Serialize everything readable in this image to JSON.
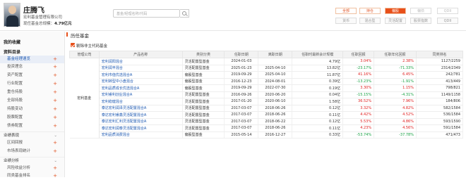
{
  "manager": {
    "name": "庄腾飞",
    "company": "宏利基金管理有限公司",
    "scale_label": "现任基金总规模：",
    "scale_value": "4.79亿元"
  },
  "search": {
    "placeholder": "基金/经理名称/代码"
  },
  "tabs_row1": [
    "全部",
    "持仓",
    "偏股",
    "偏债",
    "QDII"
  ],
  "tabs_row1_active": "偏股",
  "tabs_row2": [
    "货币",
    "混合型",
    "灵活配置",
    "股票指数",
    "QDII"
  ],
  "sidebar": {
    "my_collect": "我的收藏",
    "profile": "资料目录",
    "items": [
      "基金经理速览",
      "投资理念",
      "资产配置",
      "行业配置",
      "重仓持股",
      "全部持股",
      "持股变动",
      "股票配置",
      "债券配置"
    ],
    "sections": [
      "业绩表现",
      "业绩分析"
    ],
    "section1_items": [
      "区间回报",
      "市场表现统计"
    ],
    "section2_items": [
      "风险收益分析",
      "同类基金排名"
    ]
  },
  "main": {
    "title": "历任基金",
    "checkbox_label": "剔除非主代码基金",
    "columns": [
      "管理公司",
      "产品名称",
      "类别分类",
      "任职日期",
      "离职日期",
      "任职时最新会计规模",
      "任职回报",
      "任职年化回报",
      "同类排名"
    ],
    "company": "宏利基金",
    "rows": [
      {
        "name": "宏利润阳混合",
        "type": "灵活配置型基金",
        "start": "2024-01-03",
        "end": "",
        "scale": "4.79亿",
        "ret": "3.04%",
        "annual": "2.38%",
        "rank": "1127/2259"
      },
      {
        "name": "宏利润丰混合",
        "type": "灵活配置型基金",
        "start": "2025-01-23",
        "end": "2025-04-10",
        "scale": "13.82亿",
        "ret": "-23.17%",
        "annual": "-71.33%",
        "rank": "2314/2349"
      },
      {
        "name": "宏利市值优选混合A",
        "type": "偏股型基金",
        "start": "2019-09-29",
        "end": "2025-04-10",
        "scale": "11.87亿",
        "ret": "41.16%",
        "annual": "6.45%",
        "rank": "242/781"
      },
      {
        "name": "宏利转型中小盘混合",
        "type": "偏股型基金",
        "start": "2016-12-23",
        "end": "2024-08-01",
        "scale": "0.39亿",
        "ret": "-13.23%",
        "annual": "-1.91%",
        "rank": "413/449"
      },
      {
        "name": "宏利品质成长优选混合A",
        "type": "偏股型基金",
        "start": "2019-09-29",
        "end": "2022-07-30",
        "scale": "0.19亿",
        "ret": "3.30%",
        "annual": "1.15%",
        "rank": "798/821"
      },
      {
        "name": "宏利睿利创业混合A",
        "type": "灵活配置型基金",
        "start": "2016-09-26",
        "end": "2020-06-20",
        "scale": "0.04亿",
        "ret": "-15.15%",
        "annual": "-4.31%",
        "rank": "1149/1158"
      },
      {
        "name": "宏利稳健混合",
        "type": "灵活配置型基金",
        "start": "2017-01-20",
        "end": "2020-06-10",
        "scale": "1.58亿",
        "ret": "36.52%",
        "annual": "7.96%",
        "rank": "184/806"
      },
      {
        "name": "泰达宏利润泽灵活配置混合A",
        "type": "灵活配置型基金",
        "start": "2017-03-07",
        "end": "2018-06-26",
        "scale": "0.12亿",
        "ret": "3.32%",
        "annual": "4.82%",
        "rank": "582/1584"
      },
      {
        "name": "泰达宏利睿鑫灵活配置混合A",
        "type": "灵活配置型基金",
        "start": "2017-03-07",
        "end": "2018-06-26",
        "scale": "0.11亿",
        "ret": "4.42%",
        "annual": "4.52%",
        "rank": "536/1584"
      },
      {
        "name": "泰达宏利汇利灵活配置混合A",
        "type": "灵活配置型基金",
        "start": "2017-03-07",
        "end": "2018-06-22",
        "scale": "0.12亿",
        "ret": "5.53%",
        "annual": "4.86%",
        "rank": "593/1590"
      },
      {
        "name": "泰达宏利润泰灵活配置混合A",
        "type": "灵活配置型基金",
        "start": "2017-03-07",
        "end": "2018-06-26",
        "scale": "0.11亿",
        "ret": "4.23%",
        "annual": "4.56%",
        "rank": "591/1584"
      },
      {
        "name": "宏利品质消费混合",
        "type": "偏股型基金",
        "start": "2015-05-14",
        "end": "2016-12-27",
        "scale": "0.33亿",
        "ret": "-53.74%",
        "annual": "-37.78%",
        "rank": "471/473"
      }
    ]
  },
  "colors": {
    "accent": "#e8501a",
    "link": "#1a56b0",
    "up": "#e02020",
    "down": "#13a040"
  }
}
